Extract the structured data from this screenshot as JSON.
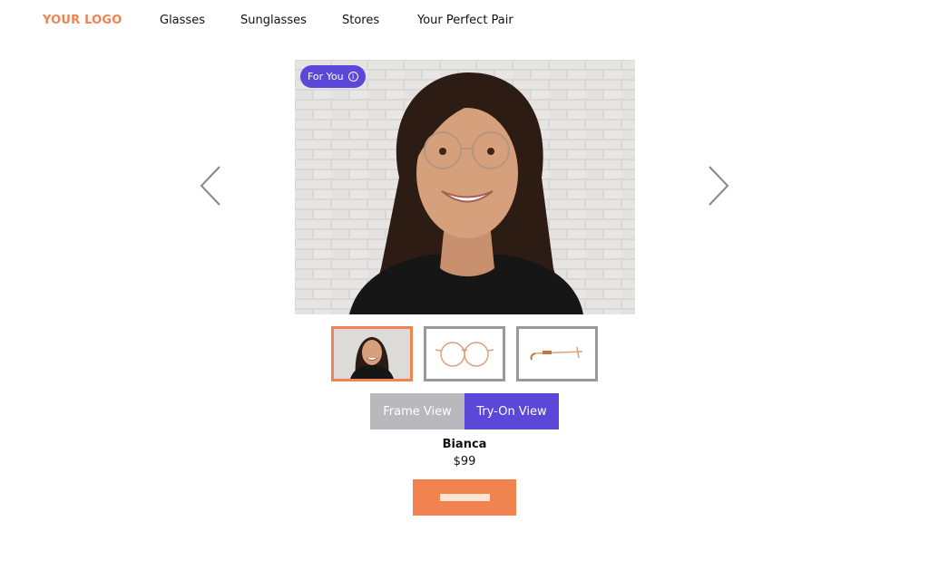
{
  "header": {
    "logo": "YOUR LOGO",
    "nav": [
      "Glasses",
      "Sunglasses",
      "Stores",
      "Your Perfect Pair"
    ]
  },
  "hero": {
    "badge_label": "For You",
    "badge_icon": "info-icon"
  },
  "carousel": {
    "prev_icon": "chevron-left-icon",
    "next_icon": "chevron-right-icon"
  },
  "thumbnails": [
    {
      "name": "try-on-photo",
      "active": true
    },
    {
      "name": "frame-front",
      "active": false
    },
    {
      "name": "frame-side",
      "active": false
    }
  ],
  "view_toggle": {
    "frame_view": "Frame View",
    "try_on_view": "Try-On View",
    "selected": "Try-On View"
  },
  "product": {
    "name": "Bianca",
    "price": "$99"
  },
  "colors": {
    "accent_orange": "#f0834f",
    "accent_purple": "#5b48d9",
    "inactive_gray": "#b8b8bd"
  }
}
